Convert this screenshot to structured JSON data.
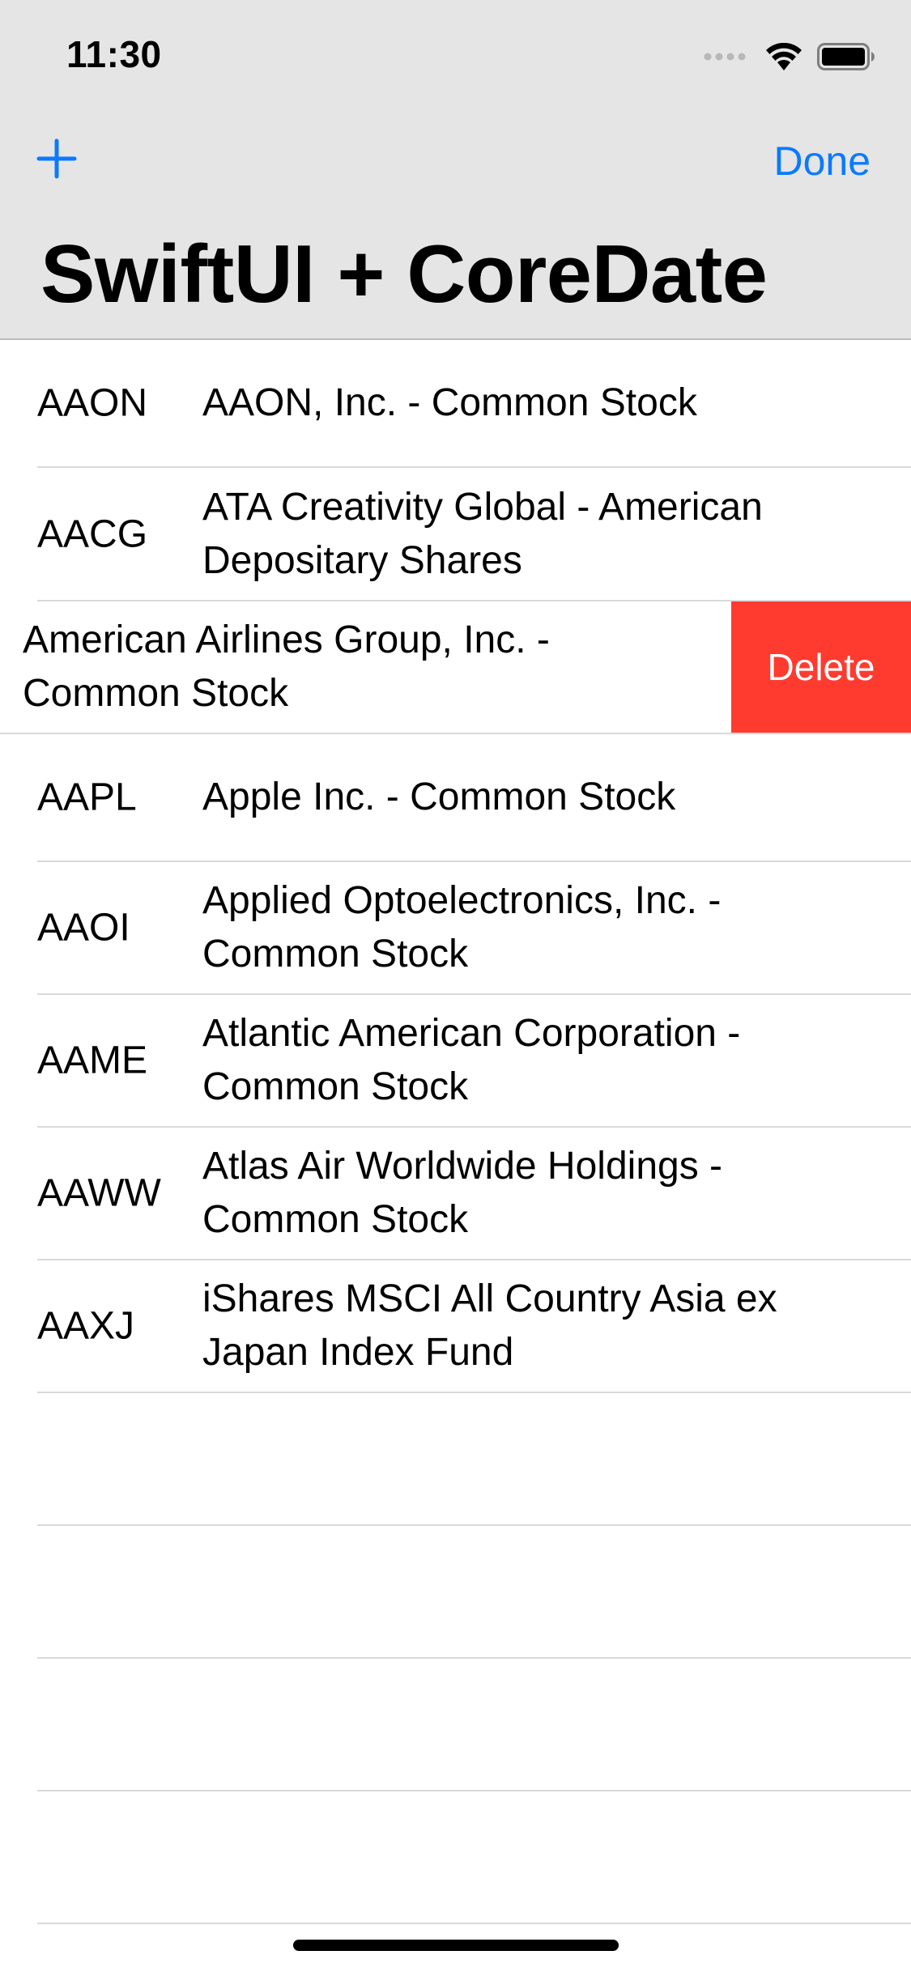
{
  "status_bar": {
    "time": "11:30",
    "icons": [
      "signal-icon",
      "wifi-icon",
      "battery-icon"
    ]
  },
  "nav": {
    "add_icon": "plus-icon",
    "done_label": "Done",
    "title": "SwiftUI + CoreDate"
  },
  "colors": {
    "accent": "#0a7aff",
    "delete": "#ff3b30",
    "header_bg": "#e5e5e5"
  },
  "rows": [
    {
      "symbol": "AAON",
      "name": "AAON, Inc. - Common Stock"
    },
    {
      "symbol": "AACG",
      "name": "ATA Creativity Global - American Depositary Shares"
    },
    {
      "symbol": "",
      "name": "American Airlines Group, Inc. - Common Stock",
      "delete_label": "Delete"
    },
    {
      "symbol": "AAPL",
      "name": "Apple Inc. - Common Stock"
    },
    {
      "symbol": "AAOI",
      "name": "Applied Optoelectronics, Inc. - Common Stock"
    },
    {
      "symbol": "AAME",
      "name": "Atlantic American Corporation - Common Stock"
    },
    {
      "symbol": "AAWW",
      "name": "Atlas Air Worldwide Holdings - Common Stock"
    },
    {
      "symbol": "AAXJ",
      "name": "iShares MSCI All Country Asia ex Japan Index Fund"
    }
  ]
}
